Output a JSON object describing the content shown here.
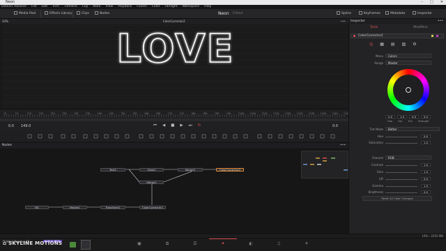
{
  "window": {
    "title": "Neon"
  },
  "menu": [
    "DaVinci Resolve",
    "File",
    "Edit",
    "Trim",
    "Timeline",
    "Clip",
    "Mark",
    "View",
    "Playback",
    "Fusion",
    "Color",
    "Fairlight",
    "Workspace",
    "Help"
  ],
  "toolbar": {
    "media_pool": "Media Pool",
    "effects_library": "Effects Library",
    "clips": "Clips",
    "nodes": "Nodes",
    "project": "Neon",
    "edited": "Edited",
    "spline": "Spline",
    "keyframes": "Keyframes",
    "metadata": "Metadata",
    "inspector": "Inspector"
  },
  "viewer": {
    "zoom": "33%",
    "node_name": "ColorCorrector2",
    "sign_text": "LOVE",
    "sign_color": "#ffffff"
  },
  "ruler": {
    "ticks": [
      "0",
      "5",
      "10",
      "15",
      "20",
      "25",
      "30",
      "35",
      "40",
      "45",
      "50",
      "55",
      "60",
      "65",
      "70",
      "75",
      "80",
      "85",
      "90",
      "95",
      "100",
      "105",
      "110",
      "115",
      "120",
      "125",
      "130",
      "135",
      "140",
      "145"
    ]
  },
  "transport": {
    "start": "0.0",
    "end": "149.0",
    "current": "0.0"
  },
  "nodes": {
    "header": "Nodes",
    "items": [
      {
        "id": "text1",
        "label": "Text1"
      },
      {
        "id": "glow1",
        "label": "Glow1"
      },
      {
        "id": "merge2",
        "label": "Merge2"
      },
      {
        "id": "cc2",
        "label": "ColorCorrector2"
      },
      {
        "id": "merge1",
        "label": "Merge1"
      },
      {
        "id": "bg",
        "label": "BG"
      },
      {
        "id": "resize1",
        "label": "Resize1"
      },
      {
        "id": "transform1",
        "label": "Transform1"
      },
      {
        "id": "cc1",
        "label": "ColorCorrector1"
      }
    ]
  },
  "inspector": {
    "header": "Inspector",
    "tab_tools": "Tools",
    "tab_modifiers": "Modifiers",
    "tool_name": "ColorCorrector2",
    "menu_label": "Menu",
    "menu_value": "Colors",
    "range_label": "Range",
    "range_value": "Master",
    "hsv": {
      "hue": "0.0",
      "sat": "1.0",
      "tint": "0.0",
      "strength": "0.0",
      "hue_lbl": "Hue",
      "sat_lbl": "Sat",
      "tint_lbl": "Tint",
      "strength_lbl": "Strength"
    },
    "tint_mode_label": "Tint Mode",
    "tint_mode_value": "Better",
    "hue_label": "Hue",
    "hue_value": "0.0",
    "saturation_label": "Saturation",
    "saturation_value": "1.0",
    "channel_label": "Channel",
    "channel_value": "RGB",
    "contrast_label": "Contrast",
    "contrast_value": "1.0",
    "gain_label": "Gain",
    "gain_value": "1.0",
    "lift_label": "Lift",
    "lift_value": "0.0",
    "gamma_label": "Gamma",
    "gamma_value": "1.0",
    "brightness_label": "Brightness",
    "brightness_value": "0.0",
    "reset_label": "Reset All Color Changes"
  },
  "status": {
    "right": "14% - 2255 MB"
  },
  "footer": {
    "app": "DaVinci Resolve 16",
    "badge": "PUBLIC BETA",
    "brand": "SKYLINE MOTIONS"
  },
  "colors": {
    "accent": "#e05252",
    "selected_node": "#e08a3a",
    "neon": "#ffffff"
  }
}
